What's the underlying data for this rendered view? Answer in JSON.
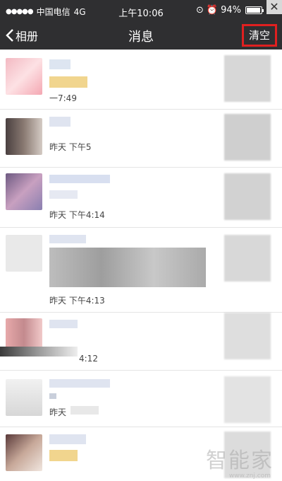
{
  "status_bar": {
    "signal": "●●●●●",
    "carrier": "中国电信",
    "network": "4G",
    "time": "上午10:06",
    "battery_percent": "94%",
    "battery_level": 0.94
  },
  "nav": {
    "back_label": "相册",
    "title": "消息",
    "clear_label": "清空"
  },
  "messages": [
    {
      "time": "一7:49"
    },
    {
      "time": "昨天 下午5"
    },
    {
      "time": "昨天 下午4:14"
    },
    {
      "time": "昨天 下午4:13"
    },
    {
      "time": "4:12"
    },
    {
      "time": "昨天"
    },
    {
      "time": ""
    }
  ],
  "watermark": {
    "text": "智能家",
    "url": "www.znj.com"
  }
}
